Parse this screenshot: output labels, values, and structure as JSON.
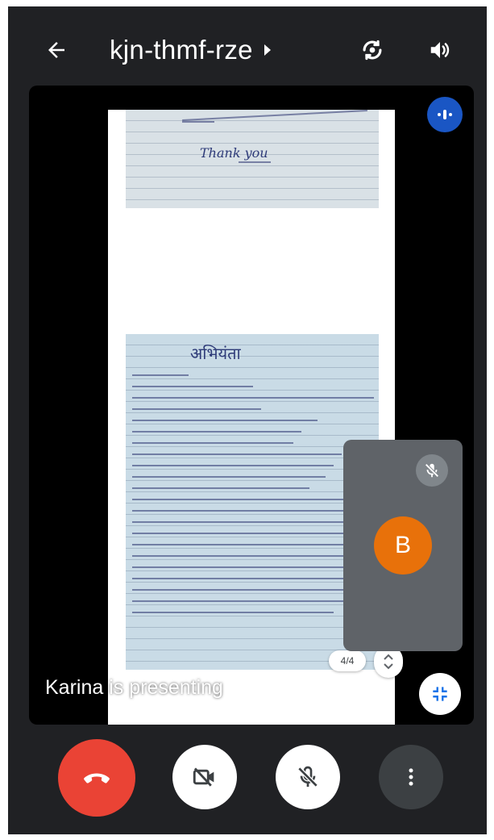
{
  "meeting": {
    "code": "kjn-thmf-rze"
  },
  "presentation": {
    "page1_text": "Thank you",
    "page2_header": "अभियंता",
    "page_indicator": "4/4",
    "presenter_caption": "Karina is presenting"
  },
  "participant_tile": {
    "initial": "B",
    "avatar_color": "#e8710a",
    "muted": true
  },
  "icons": {
    "back": "arrow-back-icon",
    "switch_camera": "switch-camera-icon",
    "speaker": "speaker-icon",
    "audio_indicator": "audio-level-icon",
    "minimize": "minimize-icon",
    "end_call": "phone-hangup-icon",
    "camera": "camera-off-icon",
    "microphone": "mic-off-icon",
    "more": "more-vert-icon"
  },
  "colors": {
    "end_call": "#ea4335",
    "audio_indicator": "#1a56c4",
    "background": "#202124"
  }
}
